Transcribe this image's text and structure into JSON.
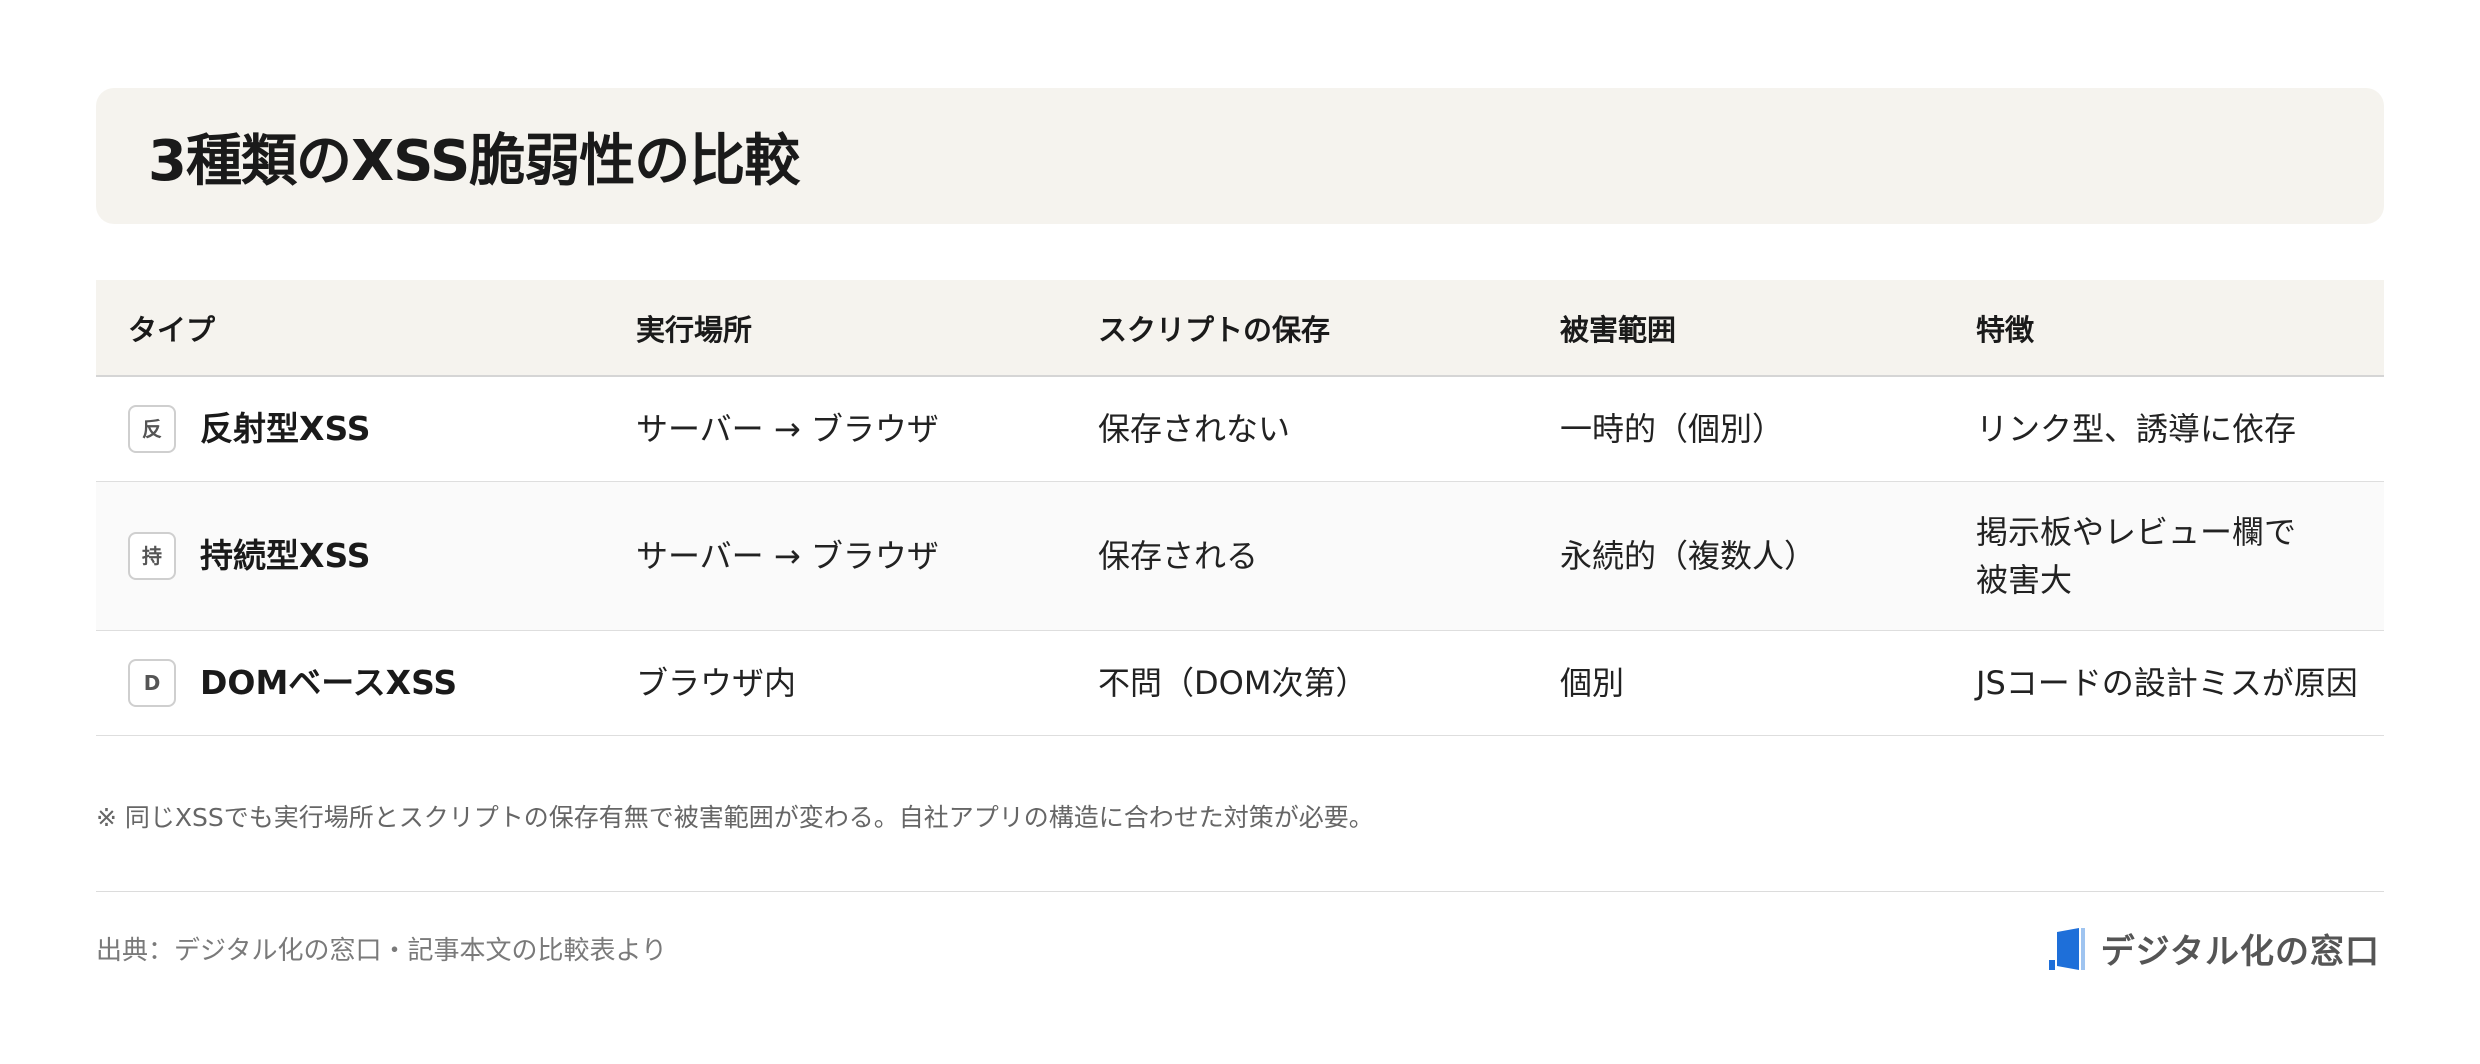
{
  "title": "3種類のXSS脆弱性の比較",
  "table": {
    "headers": [
      "タイプ",
      "実行場所",
      "スクリプトの保存",
      "被害範囲",
      "特徴"
    ],
    "rows": [
      {
        "icon": "反",
        "type": "反射型XSS",
        "location": "サーバー → ブラウザ",
        "storage": "保存されない",
        "scope": "一時的（個別）",
        "feature_line1": "リンク型、誘導に依存",
        "feature_line2": ""
      },
      {
        "icon": "持",
        "type": "持続型XSS",
        "location": "サーバー → ブラウザ",
        "storage": "保存される",
        "scope": "永続的（複数人）",
        "feature_line1": "掲示板やレビュー欄で",
        "feature_line2": "被害大"
      },
      {
        "icon": "D",
        "type": "DOMベースXSS",
        "location": "ブラウザ内",
        "storage": "不問（DOM次第）",
        "scope": "個別",
        "feature_line1": "JSコードの設計ミスが原因",
        "feature_line2": ""
      }
    ]
  },
  "note": "※ 同じXSSでも実行場所とスクリプトの保存有無で被害範囲が変わる。自社アプリの構造に合わせた対策が必要。",
  "source": "出典：デジタル化の窓口・記事本文の比較表より",
  "brand": {
    "name": "デジタル化の窓口",
    "accent": "#1e6fd9"
  }
}
